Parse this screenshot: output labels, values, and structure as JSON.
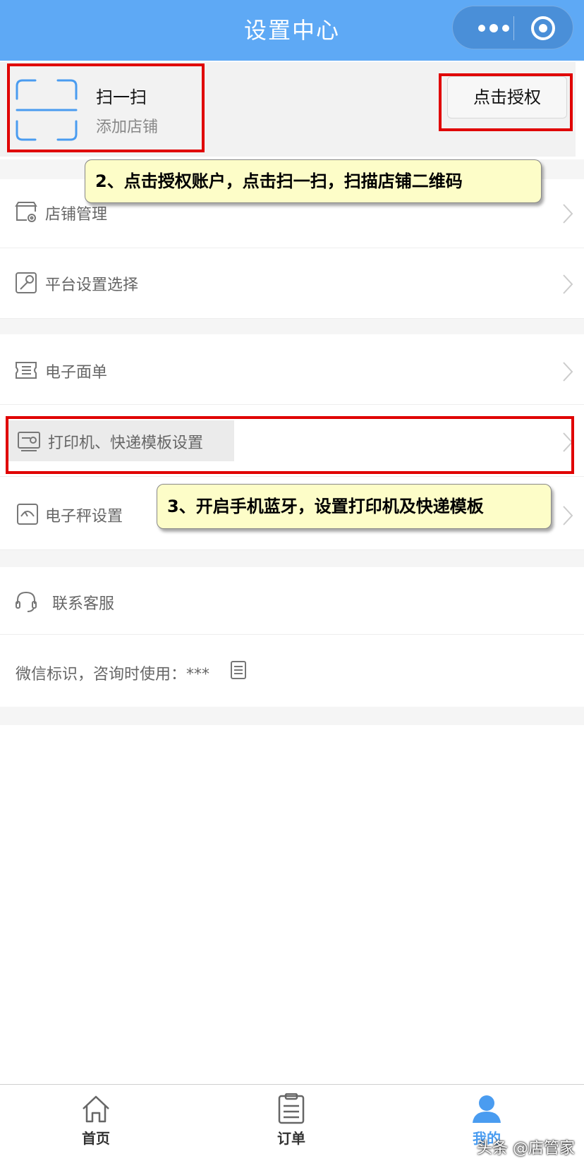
{
  "header": {
    "title": "设置中心",
    "more_icon": "more-dots-icon",
    "target_icon": "target-icon"
  },
  "scan": {
    "title": "扫一扫",
    "subtitle": "添加店铺",
    "auth_button": "点击授权"
  },
  "callouts": {
    "step2": "2、点击授权账户，点击扫一扫，扫描店铺二维码",
    "step3": "3、开启手机蓝牙，设置打印机及快递模板"
  },
  "menu": {
    "store_manage": "店铺管理",
    "platform_settings": "平台设置选择",
    "e_waybill": "电子面单",
    "printer_template": "打印机、快递模板设置",
    "scale_settings": "电子秤设置",
    "contact_service": "联系客服",
    "wechat_id": "微信标识，咨询时使用：***"
  },
  "tabbar": {
    "home": "首页",
    "orders": "订单",
    "mine": "我的"
  },
  "colors": {
    "header_bg": "#5ea9f5",
    "accent": "#4a9cf0",
    "highlight_red": "#e00000",
    "callout_bg": "#fdfdc8"
  },
  "watermark": "头条 @店管家"
}
